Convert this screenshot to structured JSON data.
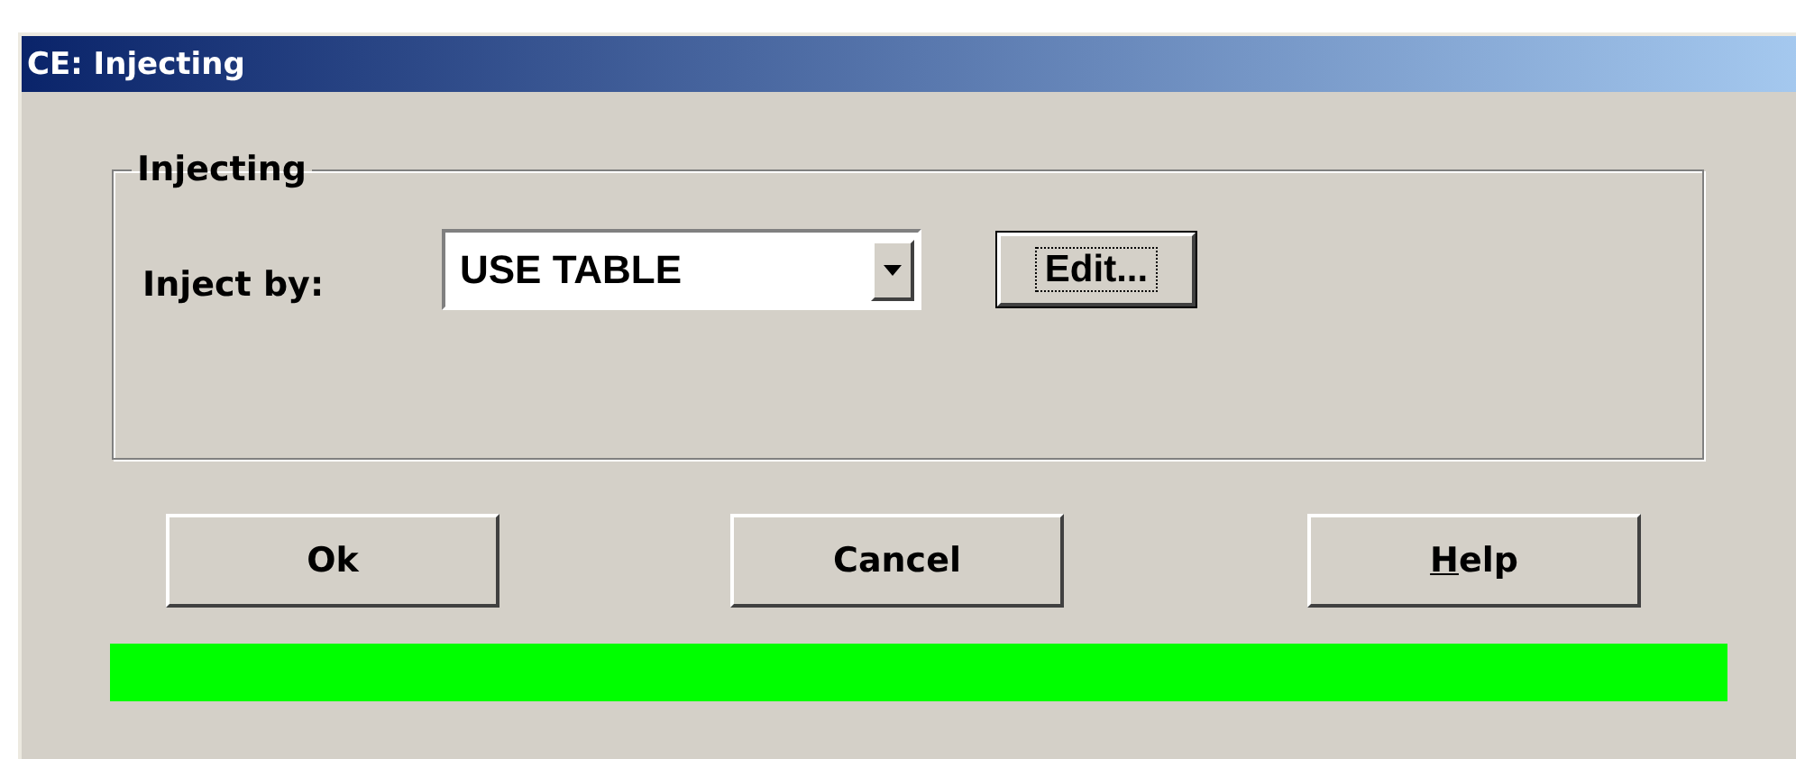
{
  "window": {
    "title": "CE: Injecting"
  },
  "group": {
    "title": "Injecting",
    "label": "Inject by:",
    "dropdown": {
      "value": "USE TABLE"
    },
    "edit_button": {
      "label": "Edit...",
      "focused": true
    }
  },
  "buttons": [
    {
      "label": "Ok",
      "underline_first": false
    },
    {
      "label": "Cancel",
      "underline_first": false
    },
    {
      "label": "Help",
      "underline_first": true
    }
  ],
  "status_indicator": {
    "kind": "ready"
  }
}
